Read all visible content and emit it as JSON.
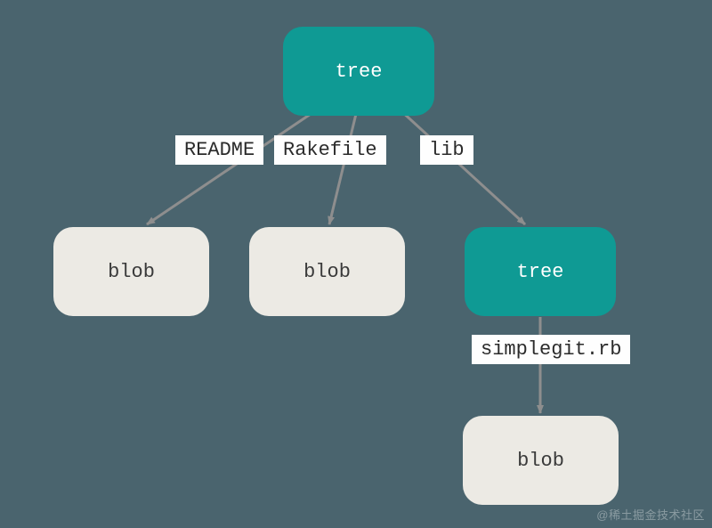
{
  "nodes": {
    "root_tree": "tree",
    "blob_readme": "blob",
    "blob_rakefile": "blob",
    "lib_tree": "tree",
    "blob_simplegit": "blob"
  },
  "edges": {
    "readme": "README",
    "rakefile": "Rakefile",
    "lib": "lib",
    "simplegit": "simplegit.rb"
  },
  "watermark": "@稀土掘金技术社区"
}
